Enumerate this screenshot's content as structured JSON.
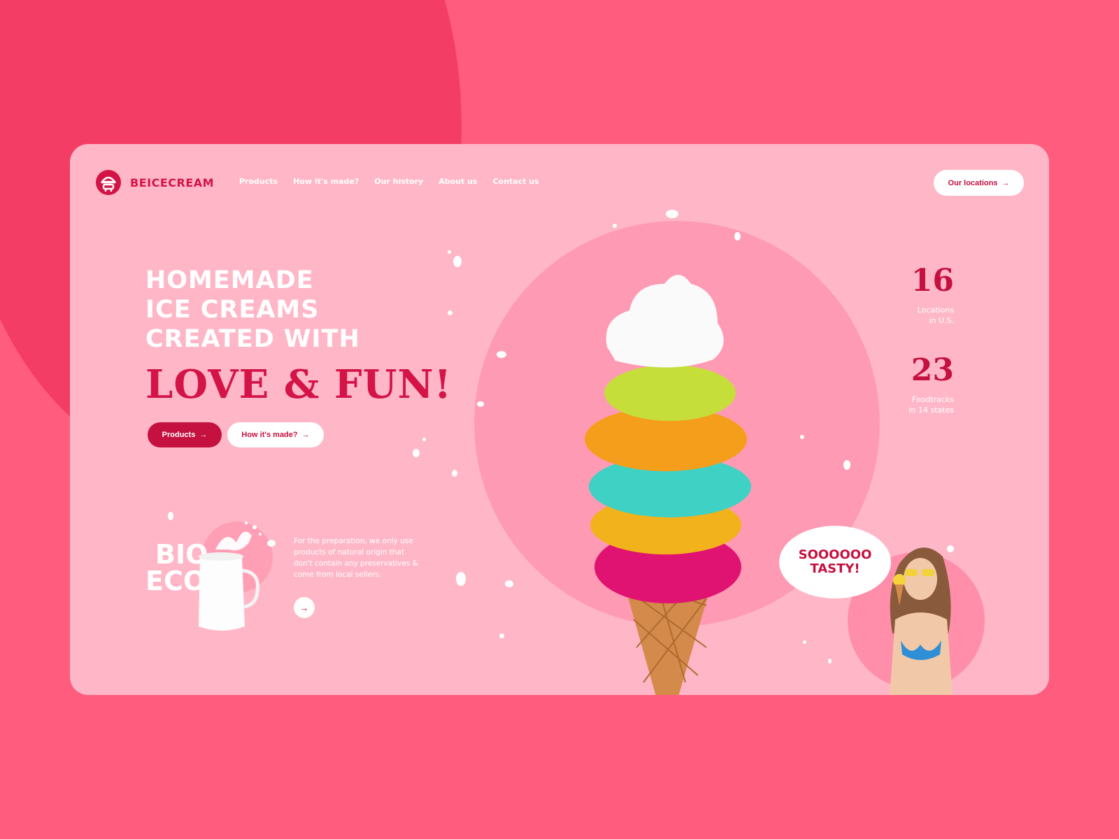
{
  "brand": {
    "name": "BEICECREAM"
  },
  "nav": [
    {
      "label": "Products"
    },
    {
      "label": "How it's made?"
    },
    {
      "label": "Our history"
    },
    {
      "label": "About us"
    },
    {
      "label": "Contact us"
    }
  ],
  "header": {
    "locations_button": "Our locations",
    "arrow": "→"
  },
  "hero": {
    "line1": "HOMEMADE",
    "line2": "ICE CREAMS",
    "line3": "CREATED WITH",
    "highlight": "LOVE & FUN!",
    "primary_button": "Products",
    "secondary_button": "How it's made?"
  },
  "bio": {
    "line1": "BIO",
    "line2": "ECO",
    "description": "For the preparation, we only use products of natural origin that don't contain any preservatives & come from local sellers.",
    "button": "→"
  },
  "stats": [
    {
      "number": "16",
      "label_line1": "Locations",
      "label_line2": "in U.S."
    },
    {
      "number": "23",
      "label_line1": "Foodtracks",
      "label_line2": "in 14 states"
    }
  ],
  "tasty": {
    "line1": "SOOOOOO",
    "line2": "TASTY!"
  },
  "colors": {
    "background": "#ff5c7e",
    "card": "#ffb7c8",
    "accent": "#c4113f",
    "circle": "#ff9ab4"
  },
  "icons": {
    "logo": "ice-cream-logo-icon",
    "arrow": "arrow-right-icon"
  }
}
